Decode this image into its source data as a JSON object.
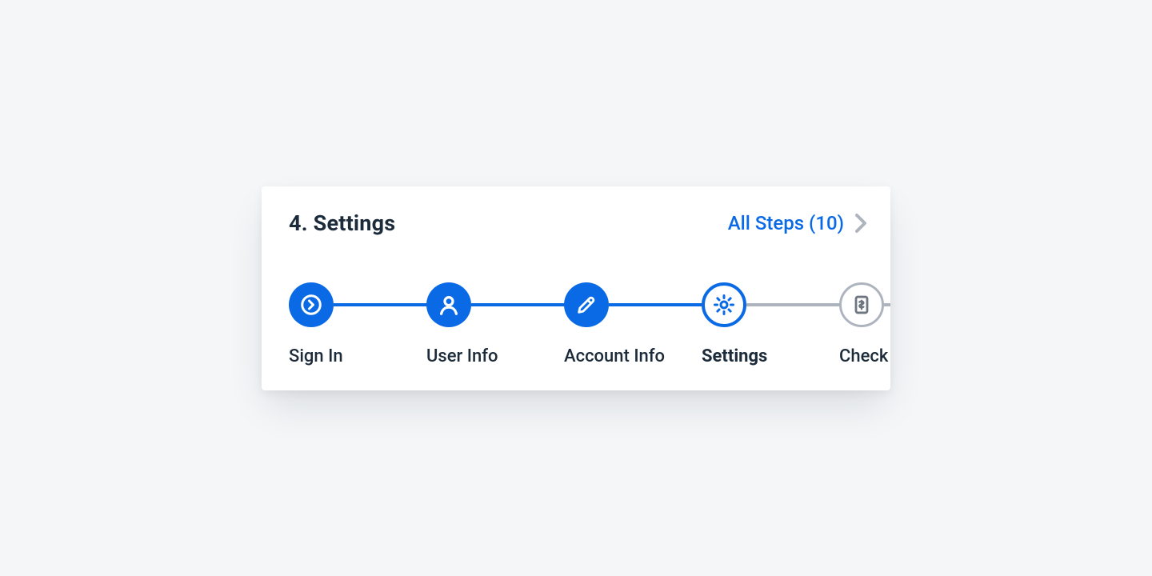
{
  "header": {
    "title": "4. Settings",
    "all_steps_label": "All Steps (10)"
  },
  "colors": {
    "accent": "#0a6ae6",
    "muted": "#aeb4be",
    "text": "#1c2b3a"
  },
  "steps": [
    {
      "label": "Sign In",
      "state": "done",
      "icon": "login"
    },
    {
      "label": "User Info",
      "state": "done",
      "icon": "user"
    },
    {
      "label": "Account Info",
      "state": "done",
      "icon": "edit"
    },
    {
      "label": "Settings",
      "state": "current",
      "icon": "gear"
    },
    {
      "label": "Check",
      "state": "upcoming",
      "icon": "receipt"
    }
  ]
}
